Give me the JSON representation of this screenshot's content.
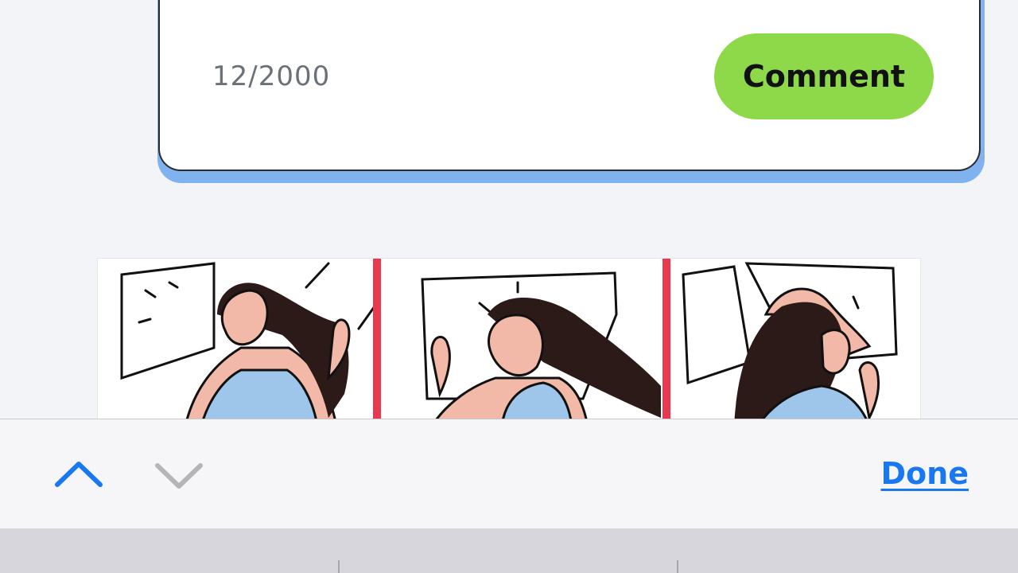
{
  "comment_box": {
    "char_count": "12/2000",
    "submit_label": "Comment"
  },
  "illustration": {
    "panels": 3,
    "divider_color": "#e8394f",
    "shirt_color": "#9ec6ea",
    "skin_color": "#f2b9a8",
    "hair_color": "#2b1a18"
  },
  "accessory_bar": {
    "up_icon": "chevron-up-icon",
    "down_icon": "chevron-down-icon",
    "done_label": "Done",
    "accent_color": "#1778f2"
  },
  "colors": {
    "comment_button": "#8ed94a",
    "card_shadow": "#7fb2ee"
  }
}
